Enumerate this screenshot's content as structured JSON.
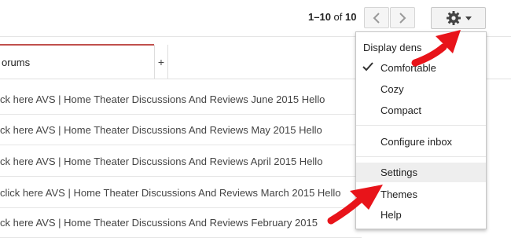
{
  "toolbar": {
    "pager_range": "1–10",
    "pager_of": "of",
    "pager_total": "10",
    "prev_icon": "chevron-left-icon",
    "next_icon": "chevron-right-icon",
    "settings_icon": "gear-icon"
  },
  "tabs": [
    {
      "label": "orums"
    }
  ],
  "tab_add_label": "+",
  "emails": [
    {
      "text": "ck here AVS | Home Theater Discussions And Reviews June 2015 Hello"
    },
    {
      "text": "ck here AVS | Home Theater Discussions And Reviews May 2015 Hello"
    },
    {
      "text": "ck here AVS | Home Theater Discussions And Reviews April 2015 Hello"
    },
    {
      "text": "click here AVS | Home Theater Discussions And Reviews March 2015 Hello"
    },
    {
      "text": "ck here AVS | Home Theater Discussions And Reviews February 2015"
    }
  ],
  "menu": {
    "heading": "Display dens",
    "density": [
      "Comfortable",
      "Cozy",
      "Compact"
    ],
    "selected_density": "Comfortable",
    "configure_inbox": "Configure inbox",
    "settings": "Settings",
    "themes": "Themes",
    "help": "Help"
  },
  "colors": {
    "tab_accent": "#c0504d",
    "annotation_arrow": "#e8141a"
  }
}
